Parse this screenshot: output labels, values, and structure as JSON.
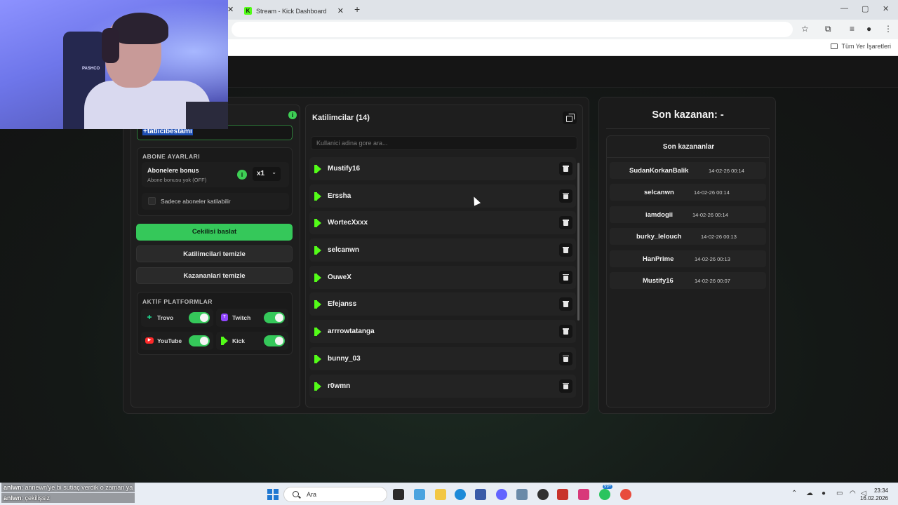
{
  "browser": {
    "tab_title": "Stream - Kick Dashboard",
    "kick_favicon": "K",
    "close_glyph": "✕",
    "new_tab": "+",
    "window_controls": {
      "minimize": "—",
      "maximize": "▢",
      "close": "✕"
    },
    "bookmarks_label": "Tüm Yer İşaretleri"
  },
  "left_panel": {
    "input_value": "+tatlicibestami",
    "abone_title": "ABONE AYARLARI",
    "abone_bonus_label": "Abonelere bonus",
    "abone_bonus_sub": "Abone bonusu yok (OFF)",
    "abone_multiplier": "x1",
    "abone_only_label": "Sadece aboneler katilabilir",
    "start_button": "Cekilisi baslat",
    "clear_participants_button": "Katilimcilari temizle",
    "clear_winners_button": "Kazananlari temizle",
    "platforms_title": "AKTİF PLATFORMLAR",
    "platforms": [
      {
        "name": "Trovo",
        "enabled": true
      },
      {
        "name": "Twitch",
        "enabled": true
      },
      {
        "name": "YouTube",
        "enabled": true
      },
      {
        "name": "Kick",
        "enabled": true
      }
    ]
  },
  "participants": {
    "title": "Katilimcilar (14)",
    "search_placeholder": "Kullanici adina gore ara...",
    "items": [
      "Mustify16",
      "Erssha",
      "WortecXxxx",
      "selcanwn",
      "OuweX",
      "Efejanss",
      "arrrowtatanga",
      "bunny_03",
      "r0wmn"
    ]
  },
  "winners": {
    "title": "Son kazanan: -",
    "list_title": "Son kazananlar",
    "items": [
      {
        "name": "SudanKorkanBalik",
        "time": "14-02-26 00:14"
      },
      {
        "name": "selcanwn",
        "time": "14-02-26 00:14"
      },
      {
        "name": "iamdogii",
        "time": "14-02-26 00:14"
      },
      {
        "name": "burky_lelouch",
        "time": "14-02-26 00:13"
      },
      {
        "name": "HanPrime",
        "time": "14-02-26 00:13"
      },
      {
        "name": "Mustify16",
        "time": "14-02-26 00:07"
      }
    ]
  },
  "webcam": {
    "chair_label": "PASHCO"
  },
  "chat": [
    {
      "user": "anlwn",
      "text": ": annewn'ye bi sutiaç verdik o zaman ya"
    },
    {
      "user": "anlwn",
      "text": ": çekilişsiz"
    }
  ],
  "taskbar": {
    "search_label": "Ara",
    "time": "23:34",
    "date": "16.02.2026",
    "badge": "99+"
  },
  "colors": {
    "accent_green": "#35c85a",
    "kick_green": "#53fc18",
    "trovo": "#1fd28b",
    "twitch": "#9146ff",
    "youtube": "#ff2a2a"
  }
}
